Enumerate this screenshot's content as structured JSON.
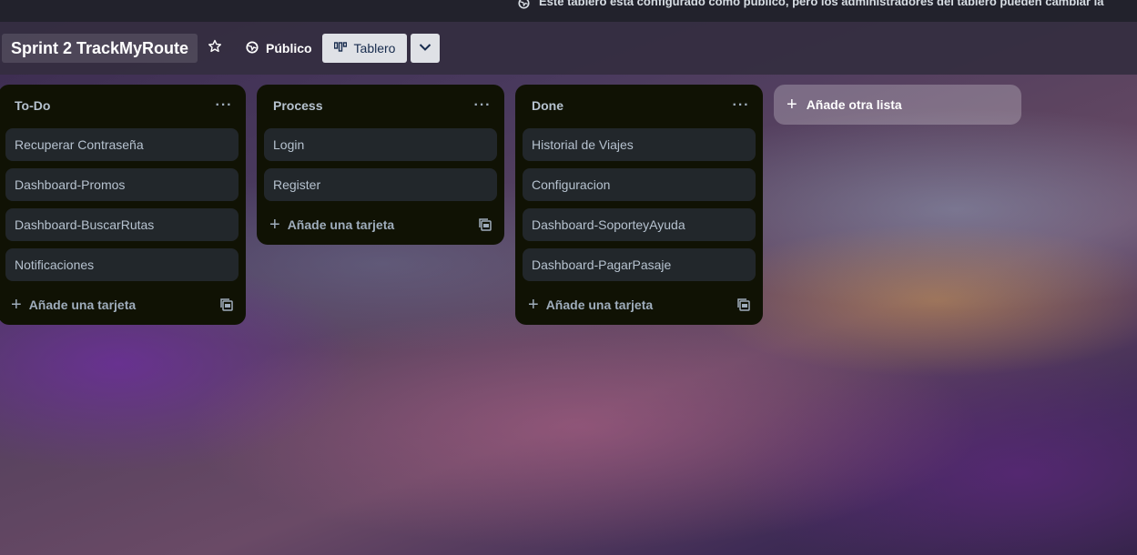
{
  "notice": {
    "text": "Este tablero está configurado como público, pero los administradores del tablero pueden cambiar la",
    "icon": "globe-icon"
  },
  "header": {
    "board_title": "Sprint 2 TrackMyRoute",
    "star_icon": "star-icon",
    "visibility_label": "Público",
    "view_label": "Tablero",
    "view_dropdown_icon": "chevron-down-icon"
  },
  "lists": [
    {
      "title": "To-Do",
      "cards": [
        "Recuperar Contraseña",
        "Dashboard-Promos",
        "Dashboard-BuscarRutas",
        "Notificaciones"
      ],
      "add_card_label": "Añade una tarjeta"
    },
    {
      "title": "Process",
      "cards": [
        "Login",
        "Register"
      ],
      "add_card_label": "Añade una tarjeta"
    },
    {
      "title": "Done",
      "cards": [
        "Historial de Viajes",
        "Configuracion",
        "Dashboard-SoporteyAyuda",
        "Dashboard-PagarPasaje"
      ],
      "add_card_label": "Añade una tarjeta"
    }
  ],
  "add_list_label": "Añade otra lista",
  "list_menu_label": "···",
  "colors": {
    "list_bg": "#101204",
    "card_bg": "#22272b",
    "text": "#b6c2cf",
    "header_btn": "#dfe1e6"
  }
}
